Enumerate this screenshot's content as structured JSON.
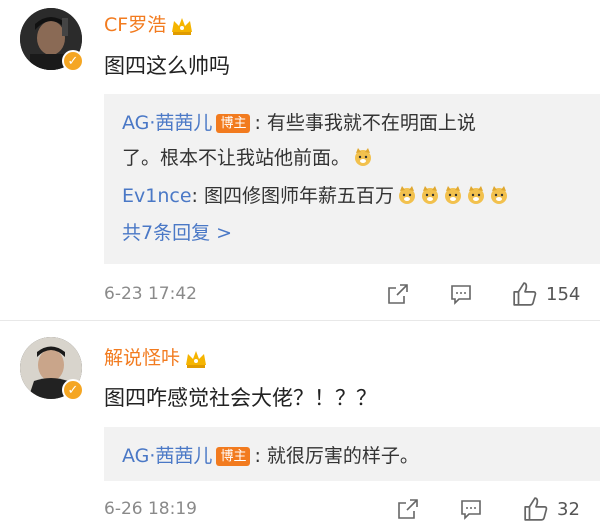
{
  "comments": [
    {
      "username": "CF罗浩",
      "text": "图四这么帅吗",
      "replies": [
        {
          "author": "AG·茜茜儿",
          "badge": "博主",
          "text_line1": "有些事我就不在明面上说",
          "text_line2": "了。根本不让我站他前面。"
        },
        {
          "author": "Ev1nce",
          "text": "图四修图师年薪五百万"
        }
      ],
      "more_replies": "共7条回复 >",
      "timestamp": "6-23 17:42",
      "like_count": "154"
    },
    {
      "username": "解说怪咔",
      "text": "图四咋感觉社会大佬？！？？",
      "replies": [
        {
          "author": "AG·茜茜儿",
          "badge": "博主",
          "text": "就很厉害的样子。"
        }
      ],
      "timestamp": "6-26 18:19",
      "like_count": "32"
    }
  ],
  "colors": {
    "username": "#f27b1f",
    "reply_author": "#4a78c6",
    "badge_bg": "#f27b1f",
    "reply_bg": "#f2f2f2",
    "meta": "#8a8a8a"
  },
  "icons": {
    "verified": "verified-badge-icon",
    "crown": "crown-icon",
    "emoji": "doge-emoji-icon",
    "share": "share-icon",
    "comment": "comment-icon",
    "like": "thumbs-up-icon"
  }
}
